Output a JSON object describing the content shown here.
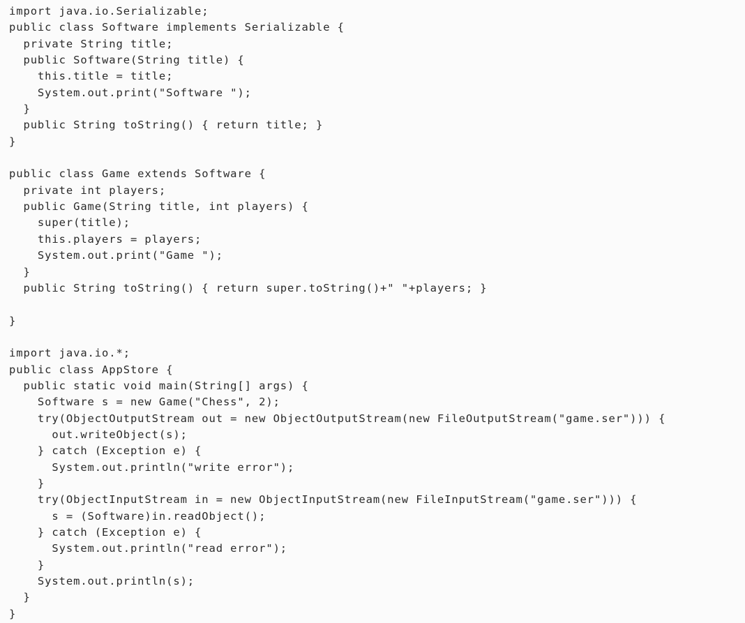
{
  "document": {
    "language": "java",
    "lines": [
      "import java.io.Serializable;",
      "public class Software implements Serializable {",
      "  private String title;",
      "  public Software(String title) {",
      "    this.title = title;",
      "    System.out.print(\"Software \");",
      "  }",
      "  public String toString() { return title; }",
      "}",
      "",
      "public class Game extends Software {",
      "  private int players;",
      "  public Game(String title, int players) {",
      "    super(title);",
      "    this.players = players;",
      "    System.out.print(\"Game \");",
      "  }",
      "  public String toString() { return super.toString()+\" \"+players; }",
      "",
      "}",
      "",
      "import java.io.*;",
      "public class AppStore {",
      "  public static void main(String[] args) {",
      "    Software s = new Game(\"Chess\", 2);",
      "    try(ObjectOutputStream out = new ObjectOutputStream(new FileOutputStream(\"game.ser\"))) {",
      "      out.writeObject(s);",
      "    } catch (Exception e) {",
      "      System.out.println(\"write error\");",
      "    }",
      "    try(ObjectInputStream in = new ObjectInputStream(new FileInputStream(\"game.ser\"))) {",
      "      s = (Software)in.readObject();",
      "    } catch (Exception e) {",
      "      System.out.println(\"read error\");",
      "    }",
      "    System.out.println(s);",
      "  }",
      "}"
    ]
  }
}
